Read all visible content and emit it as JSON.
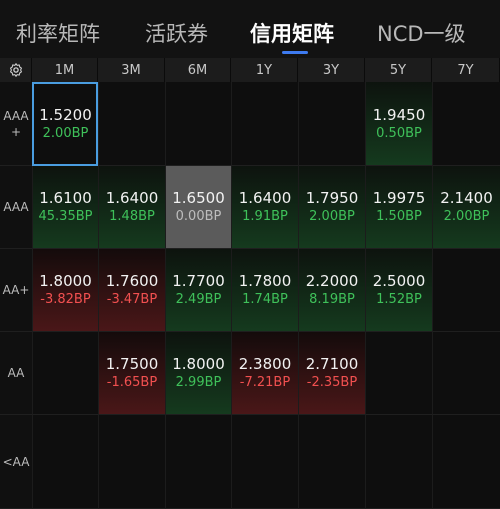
{
  "tabs": [
    {
      "label": "利率矩阵",
      "active": false
    },
    {
      "label": "活跃券",
      "active": false
    },
    {
      "label": "信用矩阵",
      "active": true
    },
    {
      "label": "NCD一级",
      "active": false
    }
  ],
  "columns": [
    "1M",
    "3M",
    "6M",
    "1Y",
    "3Y",
    "5Y",
    "7Y"
  ],
  "rows": [
    {
      "label": "AAA\n+",
      "cells": [
        {
          "rate": "1.5200",
          "bp": "2.00BP",
          "tone": "g",
          "bg": "selected"
        },
        null,
        null,
        null,
        null,
        {
          "rate": "1.9450",
          "bp": "0.50BP",
          "tone": "g",
          "bg": "green"
        },
        null
      ]
    },
    {
      "label": "AAA",
      "cells": [
        {
          "rate": "1.6100",
          "bp": "45.35BP",
          "tone": "g",
          "bg": "green"
        },
        {
          "rate": "1.6400",
          "bp": "1.48BP",
          "tone": "g",
          "bg": "green"
        },
        {
          "rate": "1.6500",
          "bp": "0.00BP",
          "tone": "n",
          "bg": "grey"
        },
        {
          "rate": "1.6400",
          "bp": "1.91BP",
          "tone": "g",
          "bg": "green"
        },
        {
          "rate": "1.7950",
          "bp": "2.00BP",
          "tone": "g",
          "bg": "green"
        },
        {
          "rate": "1.9975",
          "bp": "1.50BP",
          "tone": "g",
          "bg": "green"
        },
        {
          "rate": "2.1400",
          "bp": "2.00BP",
          "tone": "g",
          "bg": "green"
        }
      ]
    },
    {
      "label": "AA+",
      "cells": [
        {
          "rate": "1.8000",
          "bp": "-3.82BP",
          "tone": "r",
          "bg": "red"
        },
        {
          "rate": "1.7600",
          "bp": "-3.47BP",
          "tone": "r",
          "bg": "red"
        },
        {
          "rate": "1.7700",
          "bp": "2.49BP",
          "tone": "g",
          "bg": "green"
        },
        {
          "rate": "1.7800",
          "bp": "1.74BP",
          "tone": "g",
          "bg": "green"
        },
        {
          "rate": "2.2000",
          "bp": "8.19BP",
          "tone": "g",
          "bg": "green"
        },
        {
          "rate": "2.5000",
          "bp": "1.52BP",
          "tone": "g",
          "bg": "green"
        },
        null
      ]
    },
    {
      "label": "AA",
      "cells": [
        null,
        {
          "rate": "1.7500",
          "bp": "-1.65BP",
          "tone": "r",
          "bg": "red"
        },
        {
          "rate": "1.8000",
          "bp": "2.99BP",
          "tone": "g",
          "bg": "green"
        },
        {
          "rate": "2.3800",
          "bp": "-7.21BP",
          "tone": "r",
          "bg": "red"
        },
        {
          "rate": "2.7100",
          "bp": "-2.35BP",
          "tone": "r",
          "bg": "red"
        },
        null,
        null
      ]
    },
    {
      "label": "<AA",
      "cells": [
        null,
        null,
        null,
        null,
        null,
        null,
        null
      ]
    }
  ],
  "icons": {
    "settings": "gear-icon"
  },
  "colors": {
    "up": "#3fc15a",
    "down": "#f25050",
    "accent": "#3e7bf0",
    "selected": "#4a9de0"
  }
}
